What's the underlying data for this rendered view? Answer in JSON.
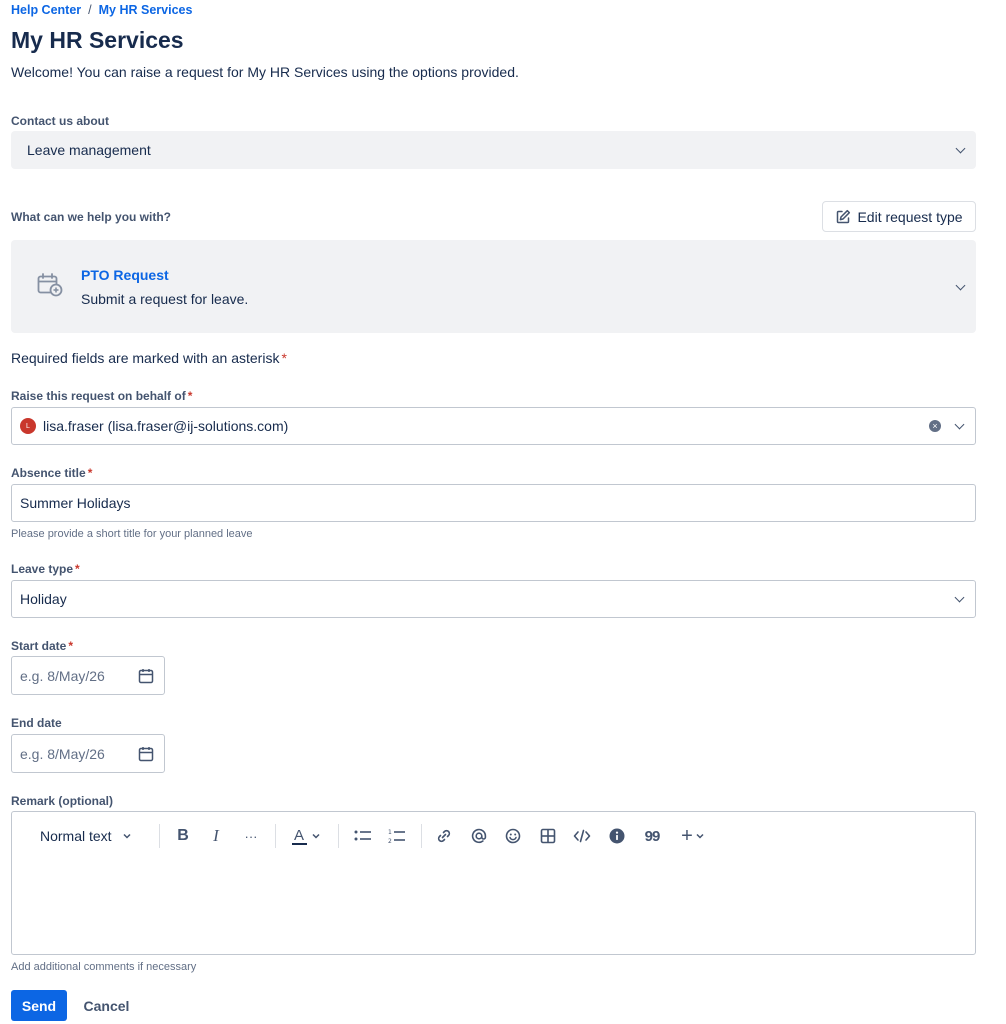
{
  "breadcrumb": {
    "home": "Help Center",
    "separator": "/",
    "current": "My HR Services"
  },
  "page": {
    "title": "My HR Services",
    "welcome": "Welcome! You can raise a request for My HR Services using the options provided."
  },
  "contact": {
    "label": "Contact us about",
    "value": "Leave management"
  },
  "help": {
    "label": "What can we help you with?",
    "edit_button": "Edit request type"
  },
  "request_type": {
    "name": "PTO Request",
    "description": "Submit a request for leave."
  },
  "required_note": {
    "text": "Required fields are marked with an asterisk",
    "asterisk": "*"
  },
  "fields": {
    "on_behalf": {
      "label": "Raise this request on behalf of",
      "asterisk": "*",
      "value": "lisa.fraser (lisa.fraser@ij-solutions.com)",
      "avatar_initial": "L"
    },
    "absence_title": {
      "label": "Absence title",
      "asterisk": "*",
      "value": "Summer Holidays",
      "helper": "Please provide a short title for your planned leave"
    },
    "leave_type": {
      "label": "Leave type",
      "asterisk": "*",
      "value": "Holiday"
    },
    "start_date": {
      "label": "Start date",
      "asterisk": "*",
      "placeholder": "e.g. 8/May/26"
    },
    "end_date": {
      "label": "End date",
      "placeholder": "e.g. 8/May/26"
    },
    "remark": {
      "label": "Remark (optional)",
      "helper": "Add additional comments if necessary"
    }
  },
  "editor_toolbar": {
    "text_style": "Normal text",
    "bold": "B",
    "italic": "I",
    "more": "···",
    "text_color": "A",
    "quote": "99",
    "insert": "+"
  },
  "actions": {
    "send": "Send",
    "cancel": "Cancel"
  },
  "colors": {
    "accent": "#0c66e4",
    "required": "#c9372c",
    "avatar": "#c9372c"
  }
}
